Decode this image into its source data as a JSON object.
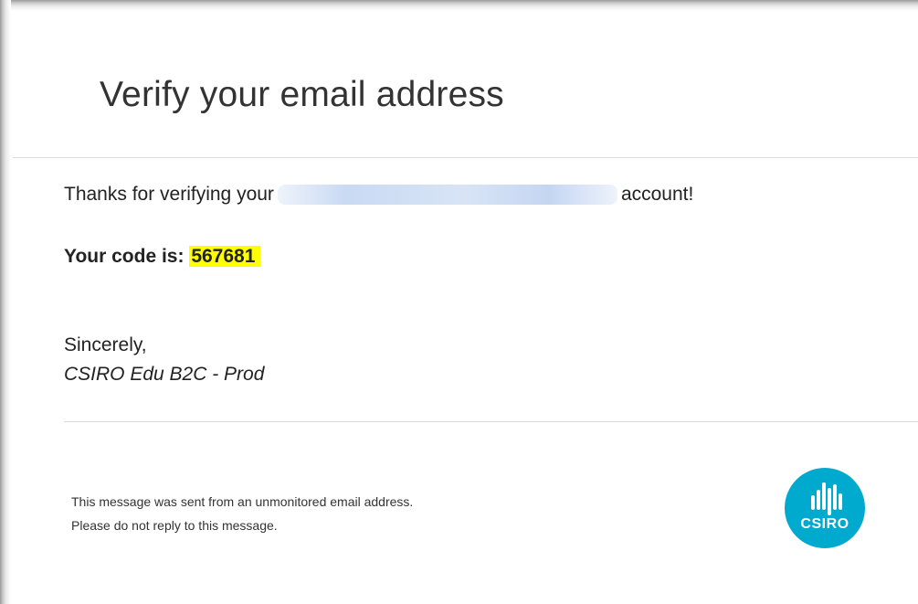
{
  "email": {
    "title": "Verify your email address",
    "thanks_prefix": "Thanks for verifying your",
    "thanks_suffix": "account!",
    "code_label": "Your code is:",
    "code_value": "567681",
    "closing": "Sincerely,",
    "signature": "CSIRO Edu B2C - Prod",
    "footer_line1": "This message was sent from an unmonitored email address.",
    "footer_line2": "Please do not reply to this message."
  },
  "logo": {
    "text": "CSIRO",
    "icon": "csiro-logo-icon",
    "color": "#00a9ce"
  },
  "colors": {
    "highlight": "#ffff00",
    "redaction": "#c9daf3"
  }
}
